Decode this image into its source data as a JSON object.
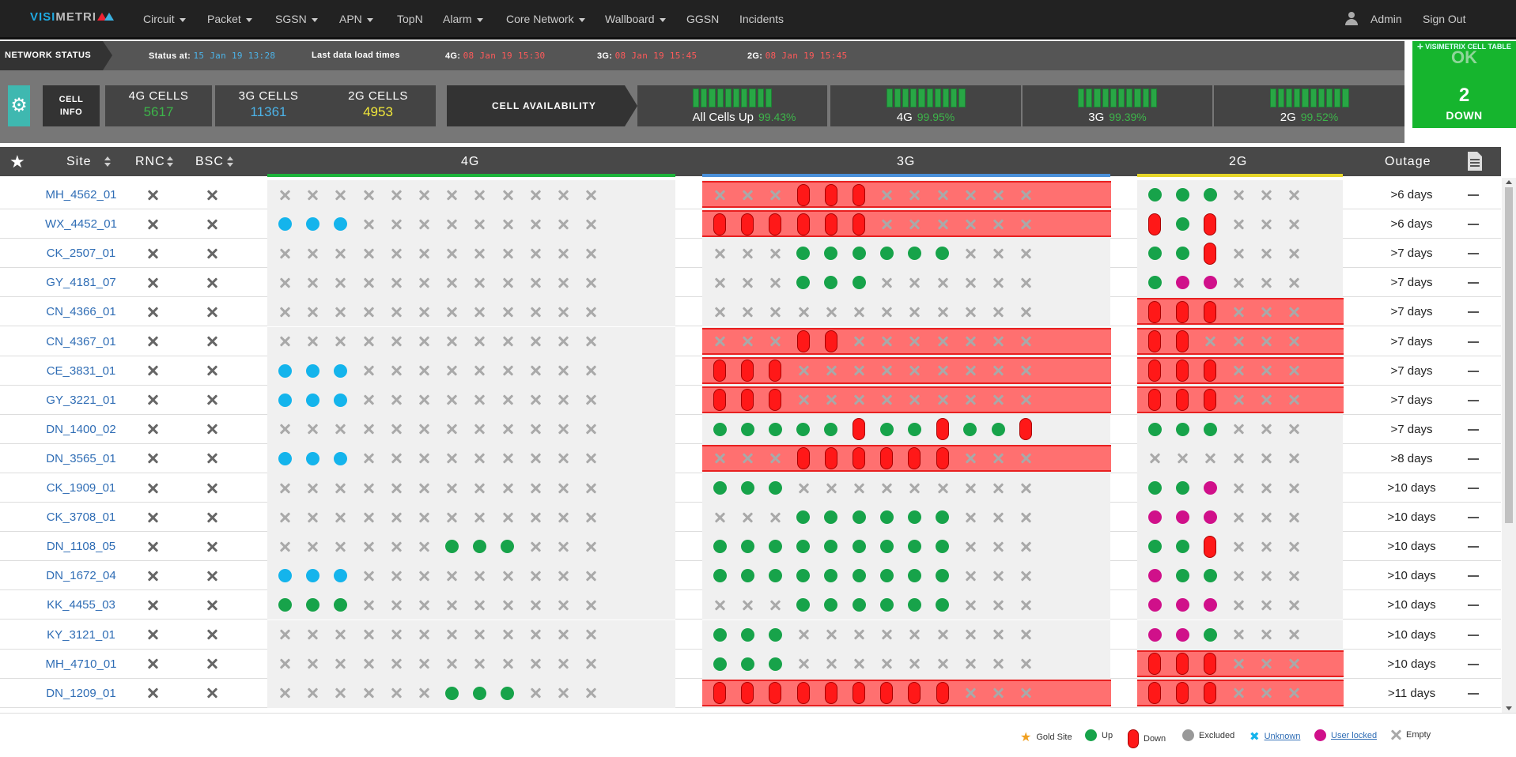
{
  "brand": {
    "part1": "VISI",
    "part2": "METRI"
  },
  "nav": {
    "items": [
      {
        "label": "Circuit",
        "dropdown": true
      },
      {
        "label": "Packet",
        "dropdown": true
      },
      {
        "label": "SGSN",
        "dropdown": true
      },
      {
        "label": "APN",
        "dropdown": true
      },
      {
        "label": "TopN",
        "dropdown": false
      },
      {
        "label": "Alarm",
        "dropdown": true
      },
      {
        "label": "Core Network",
        "dropdown": true
      },
      {
        "label": "Wallboard",
        "dropdown": true
      },
      {
        "label": "GGSN",
        "dropdown": false
      },
      {
        "label": "Incidents",
        "dropdown": false
      }
    ],
    "user": "Admin",
    "signout": "Sign Out"
  },
  "status": {
    "label": "NETWORK STATUS",
    "status_at_label": "Status at:",
    "status_at": "15 Jan 19 13:28",
    "load_label": "Last data load times",
    "g4_label": "4G:",
    "g4": "08 Jan 19 15:30",
    "g3_label": "3G:",
    "g3": "08 Jan 19 15:45",
    "g2_label": "2G:",
    "g2": "08 Jan 19 15:45"
  },
  "summary": {
    "title": "VISIMETRIX CELL TABLE",
    "ok": "OK",
    "down_count": "2",
    "down_label": "DOWN"
  },
  "cell_info": {
    "label_line1": "CELL",
    "label_line2": "INFO",
    "boxes": [
      {
        "title": "4G CELLS",
        "value": "5617",
        "color": "#3db54a"
      },
      {
        "title": "3G CELLS",
        "value": "11361",
        "color": "#4cb3e8"
      },
      {
        "title": "2G CELLS",
        "value": "4953",
        "color": "#f2e83a"
      }
    ]
  },
  "availability": {
    "label": "CELL AVAILABILITY",
    "items": [
      {
        "label": "All Cells Up",
        "pct": "99.43%"
      },
      {
        "label": "4G",
        "pct": "99.95%"
      },
      {
        "label": "3G",
        "pct": "99.39%"
      },
      {
        "label": "2G",
        "pct": "99.52%"
      }
    ]
  },
  "table": {
    "headers": {
      "site": "Site",
      "rnc": "RNC",
      "bsc": "BSC",
      "g4": "4G",
      "g3": "3G",
      "g2": "2G",
      "outage": "Outage"
    },
    "colors": {
      "g4": "#1db33a",
      "g3": "#4a90d9",
      "g2": "#e6d62a",
      "up": "#17a34a",
      "unknown": "#14b4ec",
      "locked": "#d0108a",
      "down": "#ff1818"
    },
    "rows": [
      {
        "site": "MH_4562_01",
        "g4": "xxxxxxxxxxxx",
        "g3": "xxxDDDxxxxxx",
        "g2": "UUUxxx",
        "red3": true,
        "red2": false,
        "outage": ">6 days"
      },
      {
        "site": "WX_4452_01",
        "g4": "KKKxxxxxxxxx",
        "g3": "DDDDDDxxxxxx",
        "g2": "DUDxxx",
        "red3": true,
        "red2": false,
        "outage": ">6 days"
      },
      {
        "site": "CK_2507_01",
        "g4": "xxxxxxxxxxxx",
        "g3": "xxxUUUUUUxxx",
        "g2": "UUDxxx",
        "red3": false,
        "red2": false,
        "outage": ">7 days"
      },
      {
        "site": "GY_4181_07",
        "g4": "xxxxxxxxxxxx",
        "g3": "xxxUUUxxxxxx",
        "g2": "ULLxxx",
        "red3": false,
        "red2": false,
        "outage": ">7 days"
      },
      {
        "site": "CN_4366_01",
        "g4": "xxxxxxxxxxxx",
        "g3": "xxxxxxxxxxxx",
        "g2": "DDDxxx",
        "red3": false,
        "red2": true,
        "outage": ">7 days"
      },
      {
        "site": "CN_4367_01",
        "g4": "xxxxxxxxxxxx",
        "g3": "xxxDDxxxxxxx",
        "g2": "DDxxxx",
        "red3": true,
        "red2": true,
        "outage": ">7 days"
      },
      {
        "site": "CE_3831_01",
        "g4": "KKKxxxxxxxxx",
        "g3": "DDDxxxxxxxxx",
        "g2": "DDDxxx",
        "red3": true,
        "red2": true,
        "outage": ">7 days"
      },
      {
        "site": "GY_3221_01",
        "g4": "KKKxxxxxxxxx",
        "g3": "DDDxxxxxxxxx",
        "g2": "DDDxxx",
        "red3": true,
        "red2": true,
        "outage": ">7 days"
      },
      {
        "site": "DN_1400_02",
        "g4": "xxxxxxxxxxxx",
        "g3": "UUUUUDUUDUUD",
        "g2": "UUUxxx",
        "red3": false,
        "red2": false,
        "outage": ">7 days"
      },
      {
        "site": "DN_3565_01",
        "g4": "KKKxxxxxxxxx",
        "g3": "xxxDDDDDDxxx",
        "g2": "xxxxxx",
        "red3": true,
        "red2": false,
        "outage": ">8 days"
      },
      {
        "site": "CK_1909_01",
        "g4": "xxxxxxxxxxxx",
        "g3": "UUUxxxxxxxxx",
        "g2": "UULxxx",
        "red3": false,
        "red2": false,
        "outage": ">10 days"
      },
      {
        "site": "CK_3708_01",
        "g4": "xxxxxxxxxxxx",
        "g3": "xxxUUUUUUxxx",
        "g2": "LLLxxx",
        "red3": false,
        "red2": false,
        "outage": ">10 days"
      },
      {
        "site": "DN_1108_05",
        "g4": "xxxxxxUUUxxx",
        "g3": "UUUUUUUUUxxx",
        "g2": "UUDxxx",
        "red3": false,
        "red2": false,
        "outage": ">10 days"
      },
      {
        "site": "DN_1672_04",
        "g4": "KKKxxxxxxxxx",
        "g3": "UUUUUUUUUxxx",
        "g2": "LUUxxx",
        "red3": false,
        "red2": false,
        "outage": ">10 days"
      },
      {
        "site": "KK_4455_03",
        "g4": "UUUxxxxxxxxx",
        "g3": "xxxUUUUUUxxx",
        "g2": "LLLxxx",
        "red3": false,
        "red2": false,
        "outage": ">10 days"
      },
      {
        "site": "KY_3121_01",
        "g4": "xxxxxxxxxxxx",
        "g3": "UUUxxxxxxxxx",
        "g2": "LLUxxx",
        "red3": false,
        "red2": false,
        "outage": ">10 days"
      },
      {
        "site": "MH_4710_01",
        "g4": "xxxxxxxxxxxx",
        "g3": "UUUxxxxxxxxx",
        "g2": "DDDxxx",
        "red3": false,
        "red2": true,
        "outage": ">10 days"
      },
      {
        "site": "DN_1209_01",
        "g4": "xxxxxxUUUxxx",
        "g3": "DDDDDDDDDxxx",
        "g2": "DDDxxx",
        "red3": true,
        "red2": true,
        "outage": ">11 days"
      }
    ]
  },
  "legend": {
    "gold": "Gold Site",
    "up": "Up",
    "down": "Down",
    "excluded": "Excluded",
    "unknown": "Unknown",
    "locked": "User locked",
    "empty": "Empty"
  }
}
